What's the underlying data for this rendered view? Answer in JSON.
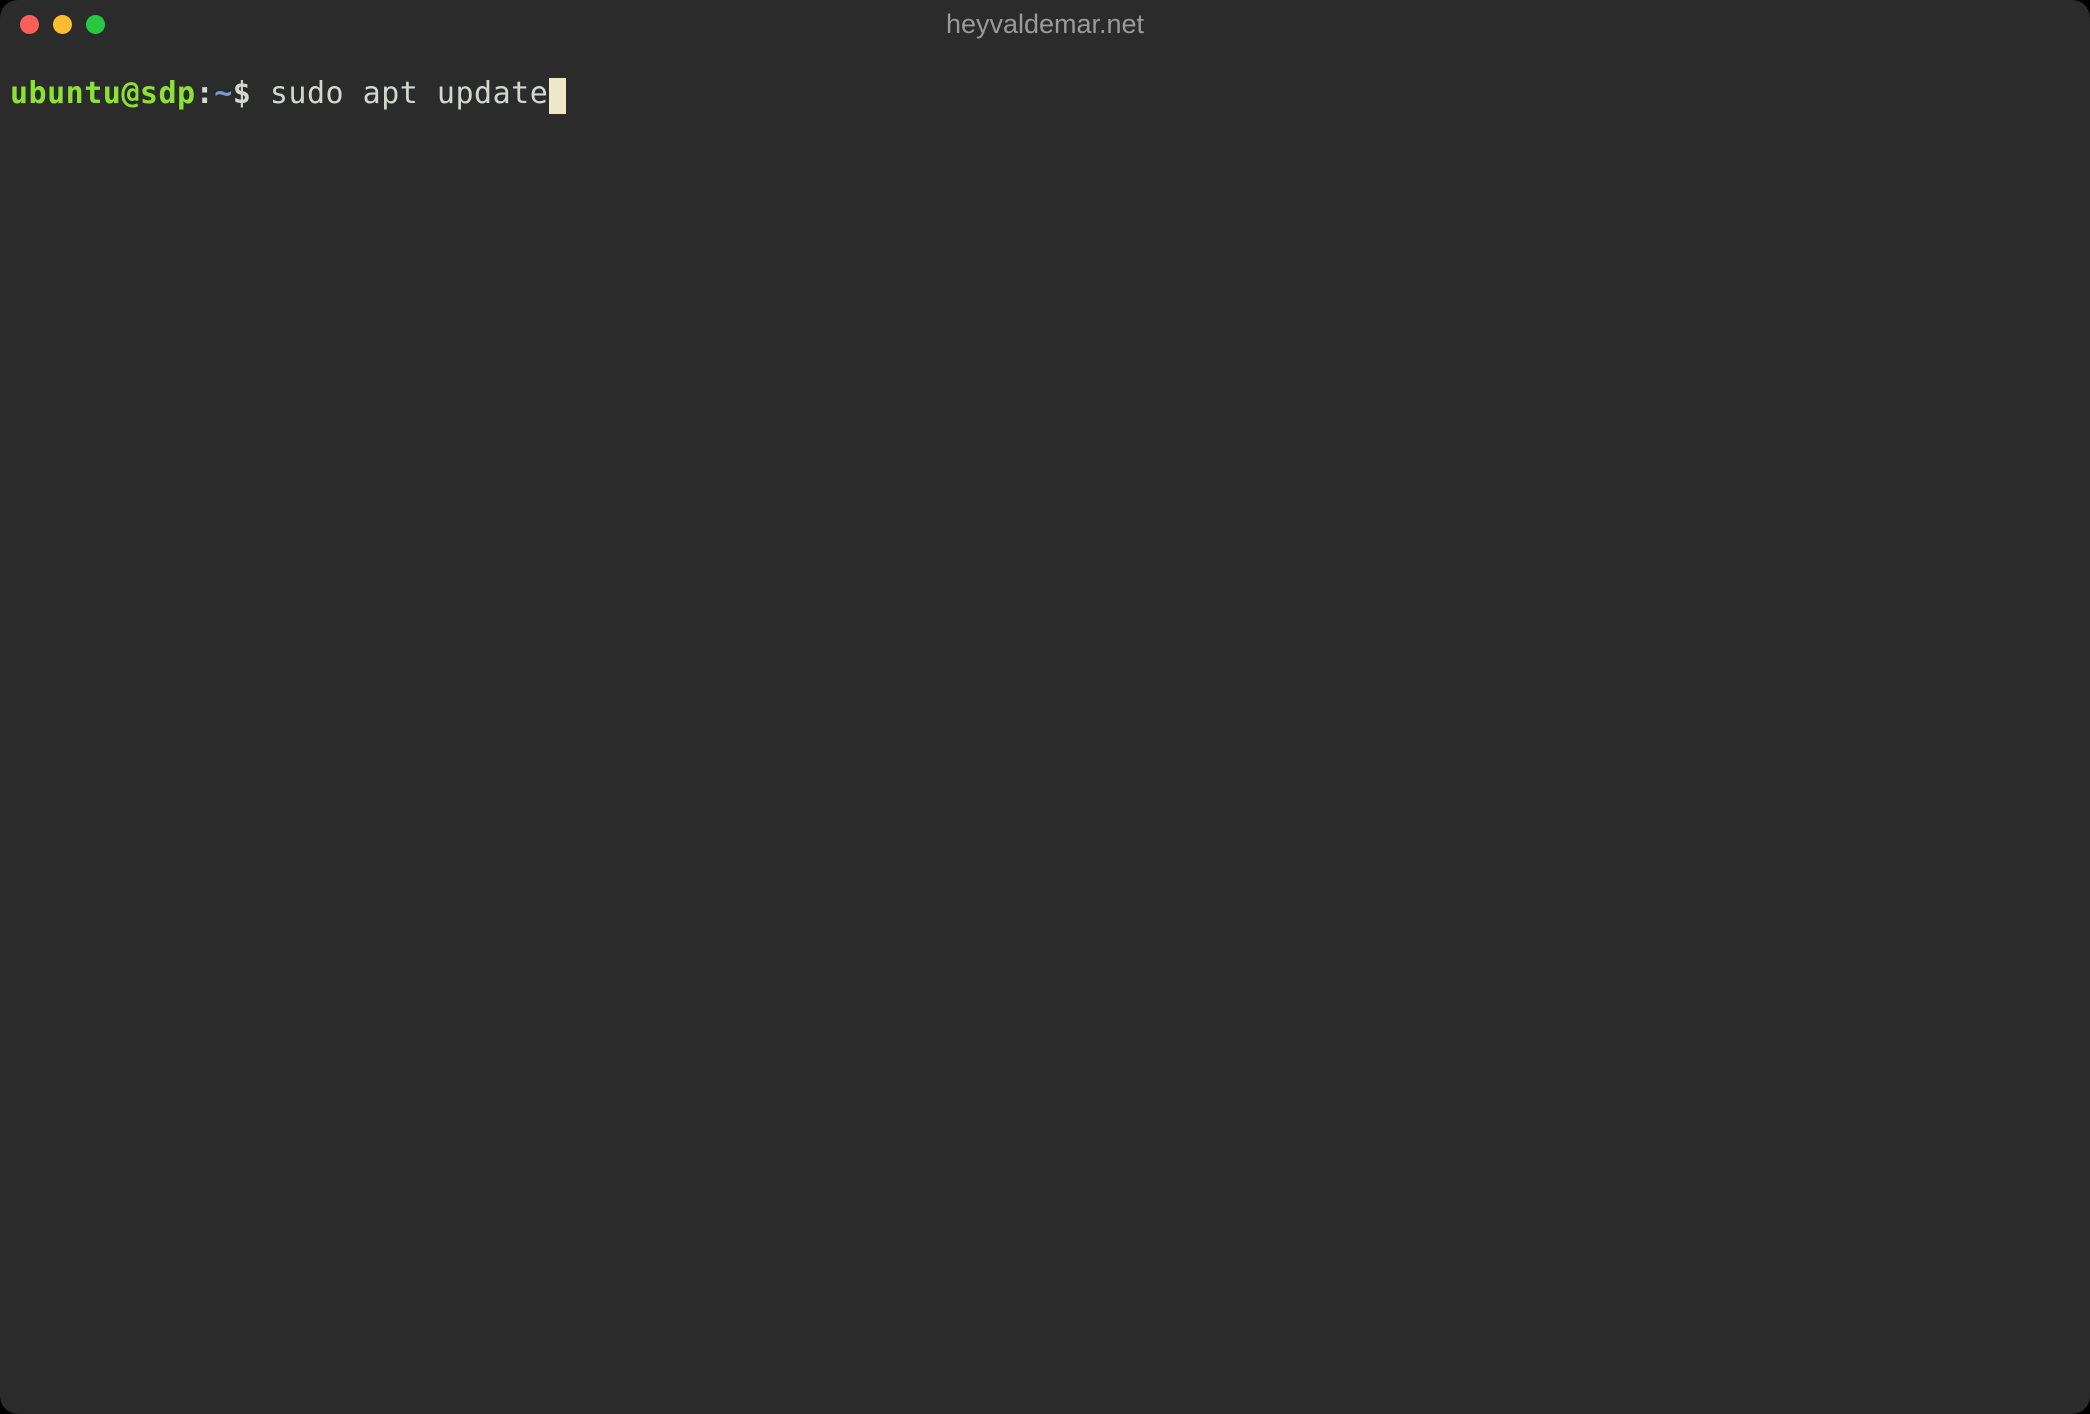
{
  "window": {
    "title": "heyvaldemar.net"
  },
  "colors": {
    "background": "#2b2b2b",
    "user_host": "#8ae234",
    "path": "#729fcf",
    "text": "#d3d7cf",
    "cursor": "#f0e8c8",
    "close": "#ff5f57",
    "minimize": "#febc2e",
    "maximize": "#28c840"
  },
  "prompt": {
    "user_host": "ubuntu@sdp",
    "colon": ":",
    "path": "~",
    "symbol": "$ ",
    "command": "sudo apt update"
  }
}
